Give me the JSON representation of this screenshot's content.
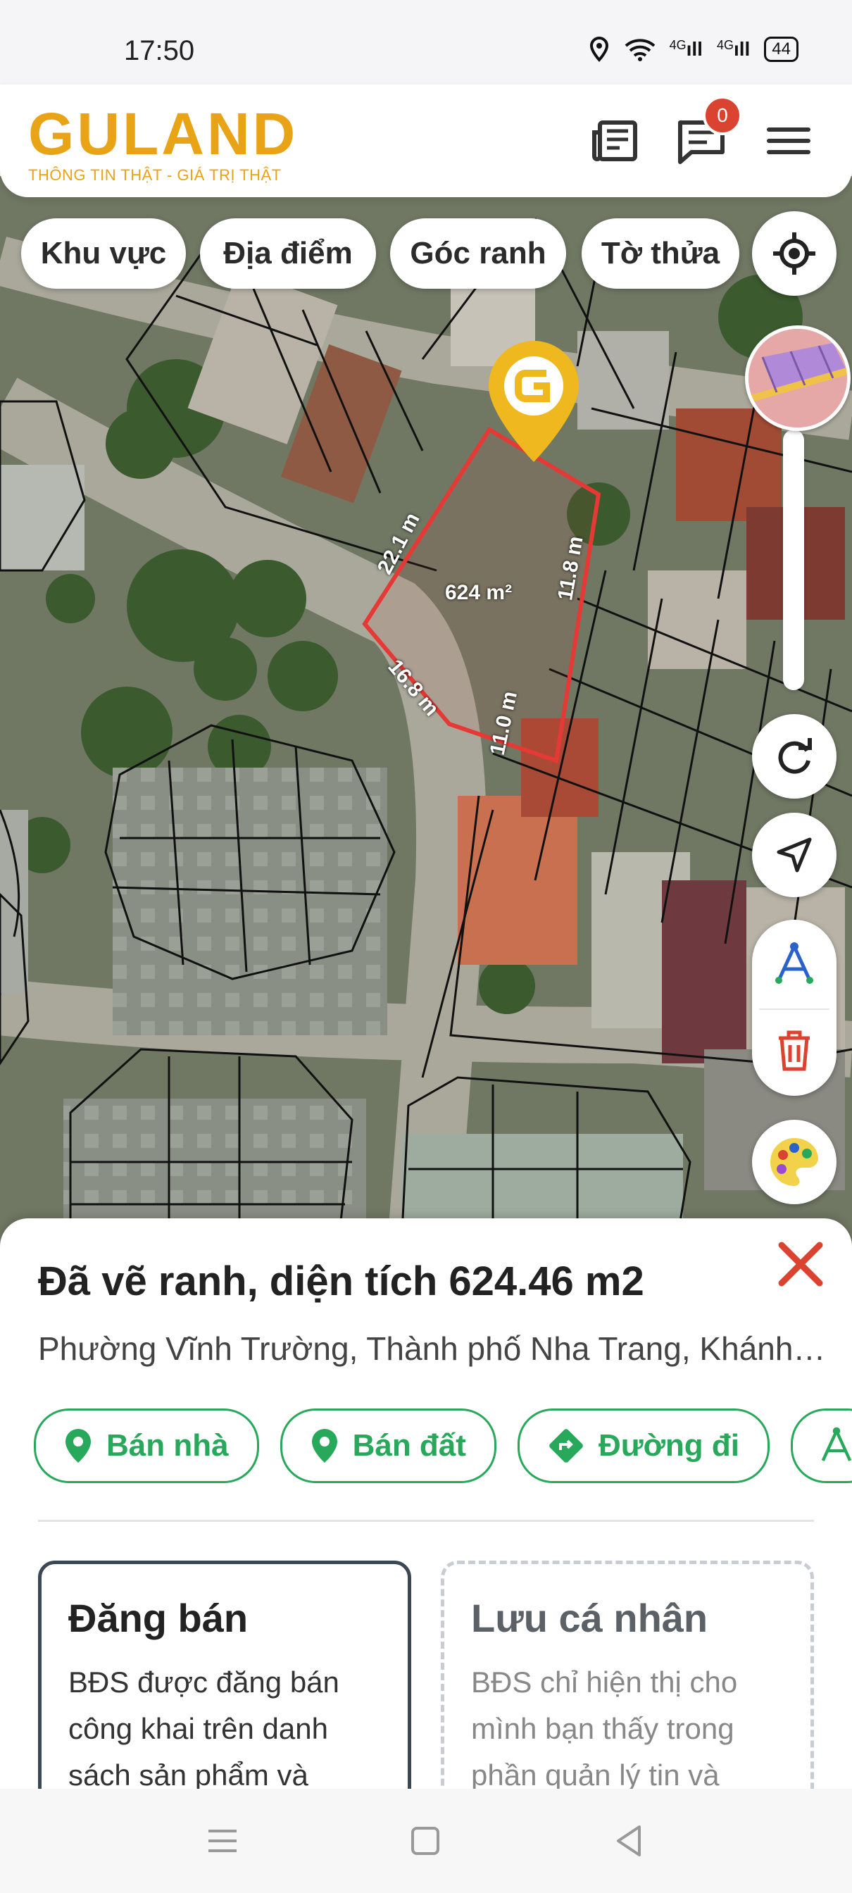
{
  "status_bar": {
    "time": "17:50",
    "network_1": "4G",
    "network_2": "4G",
    "battery": "44"
  },
  "header": {
    "logo_text": "GULAND",
    "slogan": "THÔNG TIN THẬT - GIÁ TRỊ THẬT",
    "notification_count": "0",
    "icons": [
      "news-icon",
      "chat-icon",
      "menu-icon"
    ]
  },
  "map": {
    "filters": [
      "Khu vực",
      "Địa điểm",
      "Góc ranh",
      "Tờ thửa"
    ],
    "area_label": "624 m²",
    "edges": [
      "22.1 m",
      "11.8 m",
      "16.8 m",
      "11.0 m"
    ],
    "tools": [
      "locate-icon",
      "layer-thumbnail",
      "refresh-icon",
      "navigate-icon",
      "measure-icon",
      "trash-icon",
      "palette-icon"
    ],
    "accent_red": "#e53935",
    "pin_color": "#f0b81f"
  },
  "sheet": {
    "title": "Đã vẽ ranh, diện tích 624.46 m2",
    "address": "Phường Vĩnh Trường, Thành phố Nha Trang, Khánh Hòa",
    "actions": [
      {
        "label": "Bán nhà",
        "icon": "location-pin-icon"
      },
      {
        "label": "Bán đất",
        "icon": "location-pin-icon"
      },
      {
        "label": "Đường đi",
        "icon": "directions-icon"
      },
      {
        "label": "",
        "icon": "measure-icon"
      }
    ],
    "accent_green": "#27a85a",
    "cards": [
      {
        "title": "Đăng bán",
        "text": "BĐS được đăng bán công khai trên danh sách sản phẩm và"
      },
      {
        "title": "Lưu cá nhân",
        "text": "BĐS chỉ hiện thị cho mình bạn thấy trong phần quản lý tin và"
      }
    ]
  },
  "nav_bar": [
    "menu-nav",
    "home-nav",
    "back-nav"
  ]
}
